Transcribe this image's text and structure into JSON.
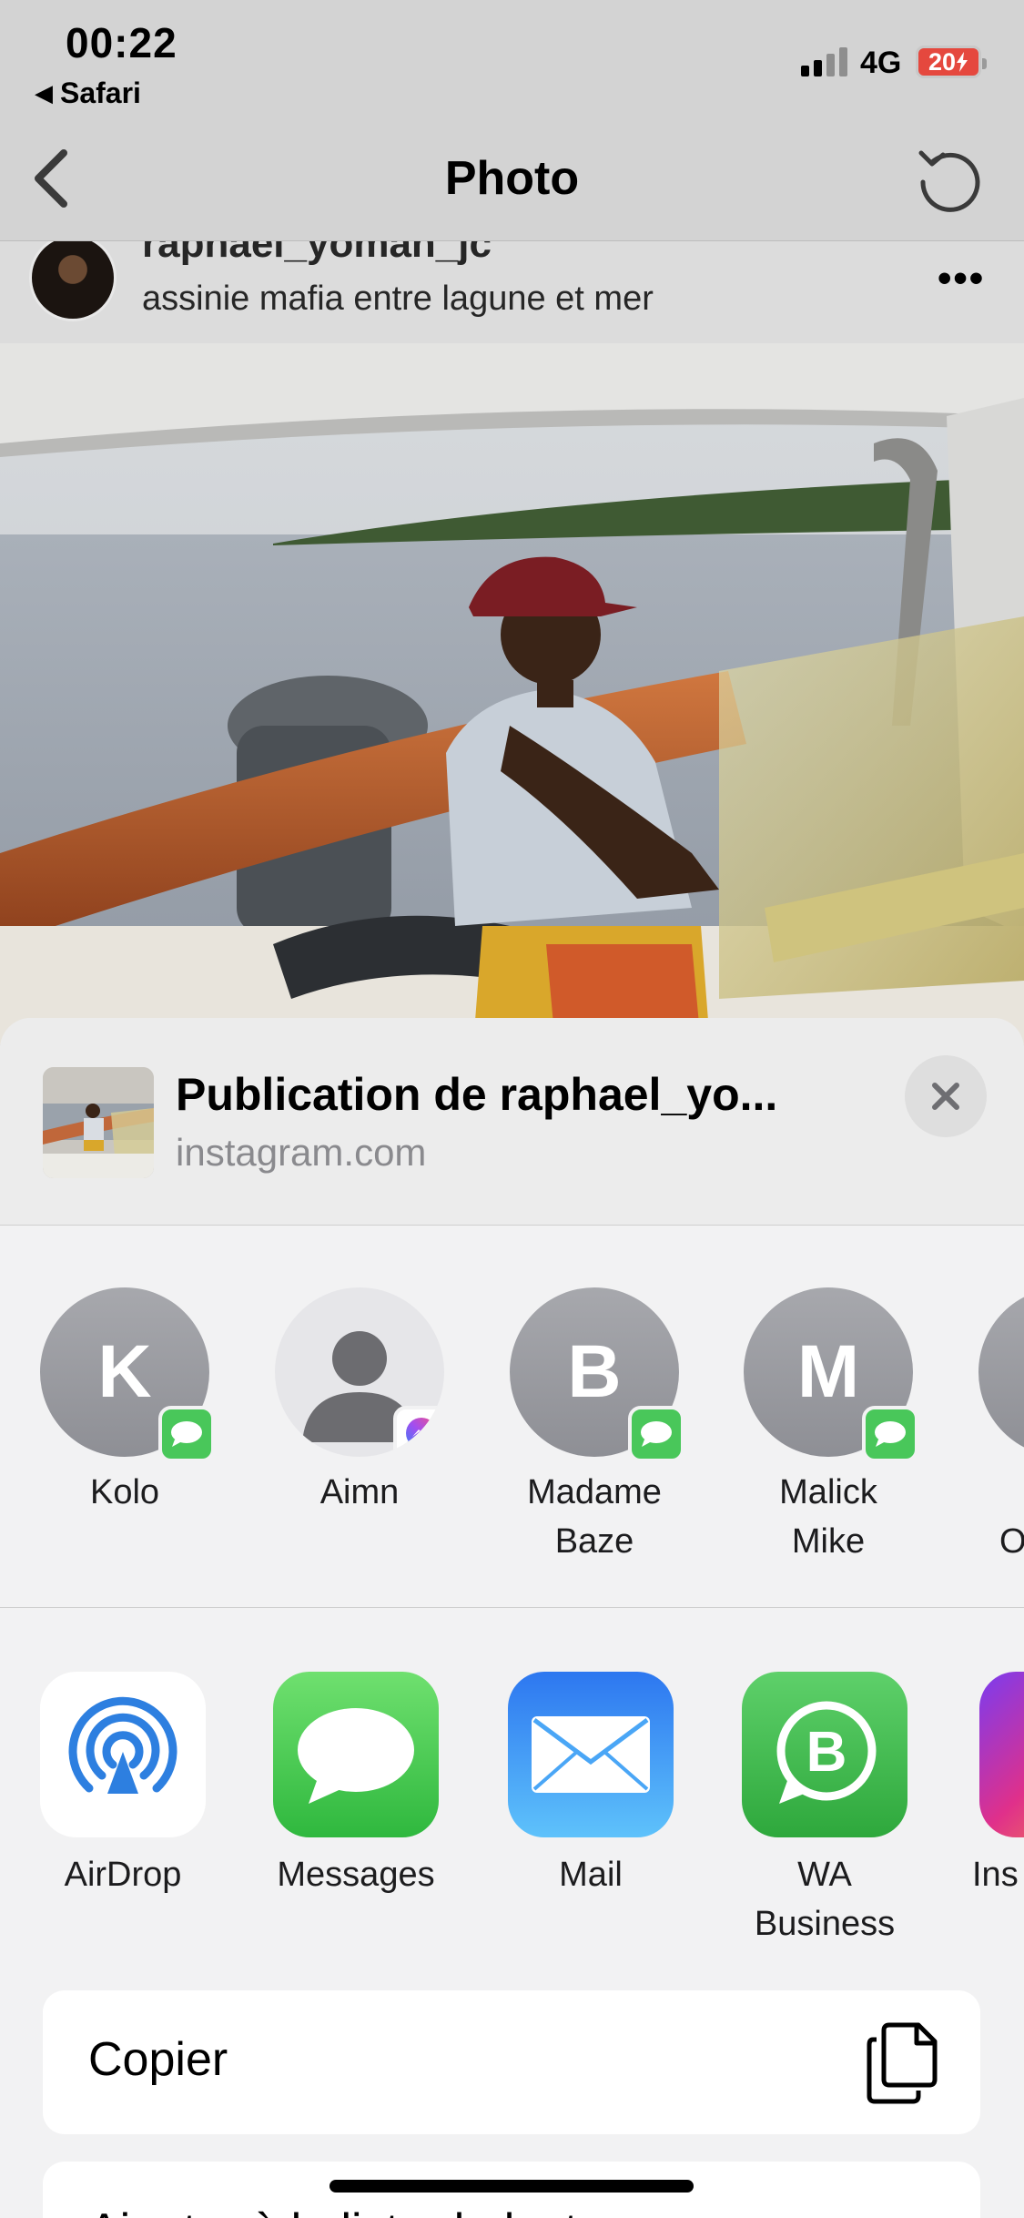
{
  "status_bar": {
    "time": "00:22",
    "back_app": "Safari",
    "network": "4G",
    "battery": "20",
    "battery_color": "#e5483e"
  },
  "nav": {
    "title": "Photo",
    "back_icon": "chevron-left-icon",
    "refresh_icon": "refresh-icon"
  },
  "post": {
    "username": "raphael_yoman_jc",
    "location": "assinie mafia entre lagune et mer",
    "more_label": "•••"
  },
  "share": {
    "title": "Publication de raphael_yo...",
    "url": "instagram.com",
    "close_icon": "close-icon"
  },
  "contacts": [
    {
      "initial": "K",
      "name": "Kolo",
      "badge": "messages"
    },
    {
      "initial": "",
      "name": "Aimn",
      "badge": "messenger"
    },
    {
      "initial": "B",
      "name": "Madame\nBaze",
      "badge": "messages"
    },
    {
      "initial": "M",
      "name": "Malick\nMike",
      "badge": "messages"
    },
    {
      "initial": "",
      "name": "O",
      "badge": "messages"
    }
  ],
  "apps": [
    {
      "name": "AirDrop",
      "icon": "airdrop-icon"
    },
    {
      "name": "Messages",
      "icon": "messages-icon"
    },
    {
      "name": "Mail",
      "icon": "mail-icon"
    },
    {
      "name": "WA\nBusiness",
      "icon": "whatsapp-business-icon"
    },
    {
      "name": "Ins",
      "icon": "instagram-icon"
    }
  ],
  "actions": [
    {
      "label": "Copier",
      "icon": "copy-icon"
    },
    {
      "label": "Ajouter à la liste de lecture",
      "icon": "glasses-icon"
    }
  ],
  "colors": {
    "messages_green": "#49c75a",
    "mail_blue": "#2f8cf2",
    "airdrop_blue": "#2d7fe0",
    "wa_green": "#3bb54a"
  }
}
